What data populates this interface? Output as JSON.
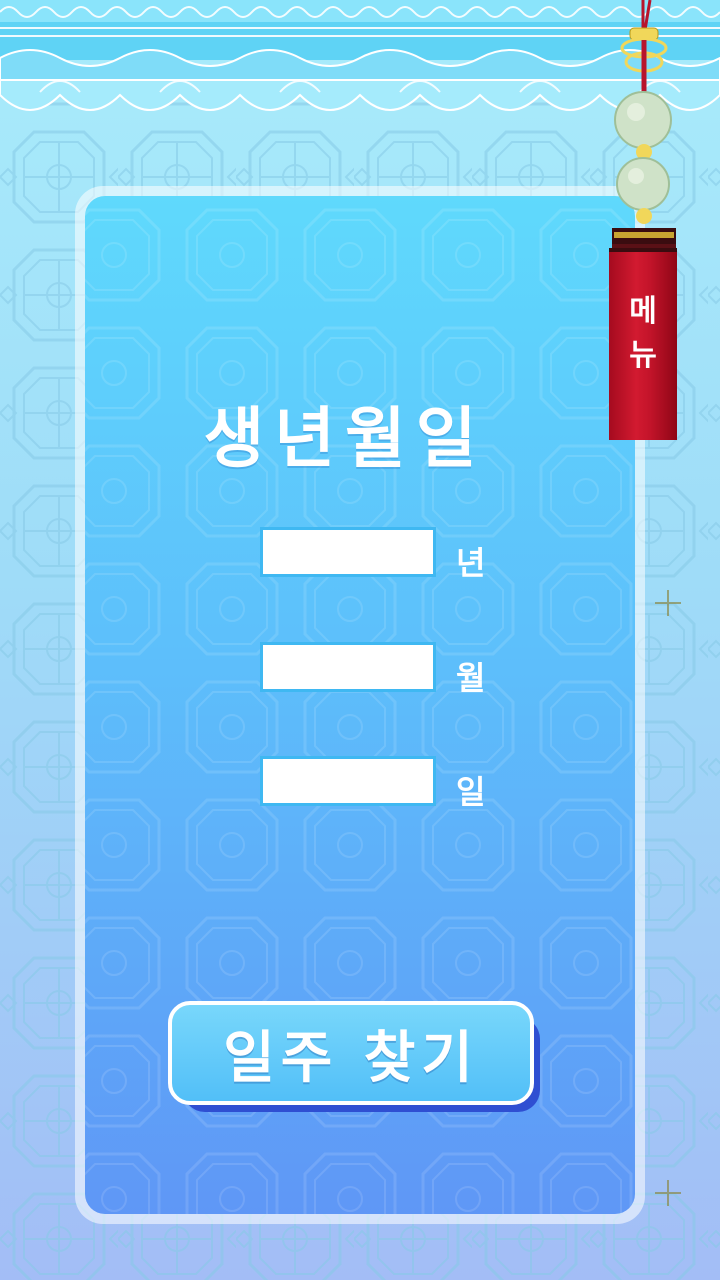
{
  "title": "생년월일",
  "fields": [
    {
      "name": "year",
      "value": "",
      "unit": "년"
    },
    {
      "name": "month",
      "value": "",
      "unit": "월"
    },
    {
      "name": "day",
      "value": "",
      "unit": "일"
    }
  ],
  "button": {
    "label": "일주 찾기"
  },
  "menu": {
    "char1": "메",
    "char2": "뉴"
  },
  "icons": [
    "lattice-pattern",
    "cloud-border",
    "jade-ornament",
    "tassel"
  ],
  "colors": {
    "card_top": "#5fd9fc",
    "card_bottom": "#5f97f6",
    "tassel_red": "#c3142a",
    "button_shadow": "#2f4fd2"
  }
}
